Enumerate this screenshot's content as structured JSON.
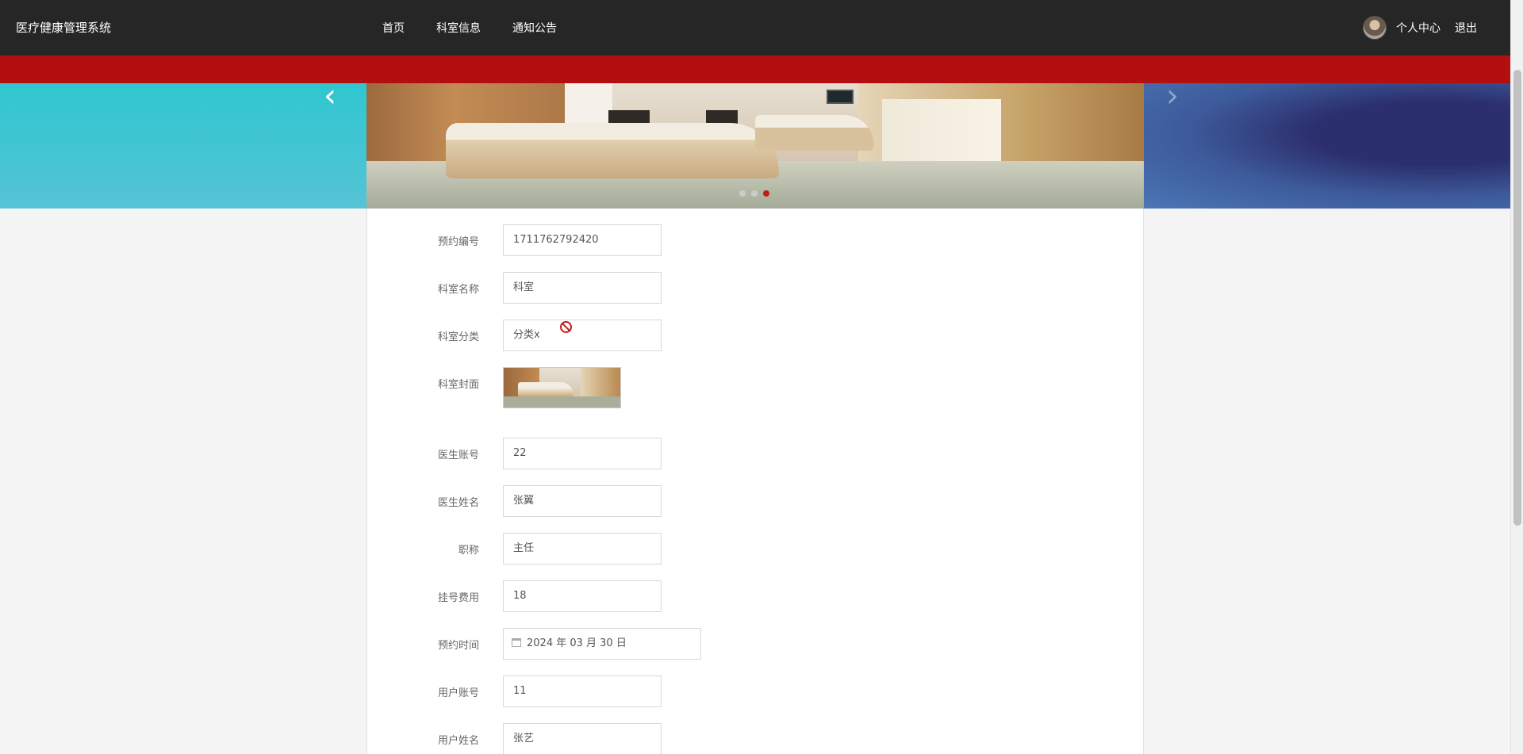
{
  "app": {
    "title": "医疗健康管理系统"
  },
  "nav": {
    "items": [
      {
        "label": "首页"
      },
      {
        "label": "科室信息"
      },
      {
        "label": "通知公告"
      }
    ]
  },
  "user": {
    "avatar_icon": "user-avatar",
    "center_label": "个人中心",
    "logout_label": "退出"
  },
  "carousel": {
    "prev_glyph": "‹",
    "next_glyph": "›",
    "slide_count": 3,
    "active_index": 2
  },
  "form": {
    "fields": [
      {
        "label": "预约编号",
        "value": "1711762792420"
      },
      {
        "label": "科室名称",
        "value": "科室"
      },
      {
        "label": "科室分类",
        "value": "分类x"
      },
      {
        "label": "科室封面",
        "value": ""
      },
      {
        "label": "医生账号",
        "value": "22"
      },
      {
        "label": "医生姓名",
        "value": "张翼"
      },
      {
        "label": "职称",
        "value": "主任"
      },
      {
        "label": "挂号费用",
        "value": "18"
      },
      {
        "label": "预约时间",
        "value": "2024 年 03 月 30 日"
      },
      {
        "label": "用户账号",
        "value": "11"
      },
      {
        "label": "用户姓名",
        "value": "张艺"
      }
    ]
  },
  "colors": {
    "navbar": "#262626",
    "accent_red": "#b30f10",
    "active_dot": "#c41a1a"
  }
}
